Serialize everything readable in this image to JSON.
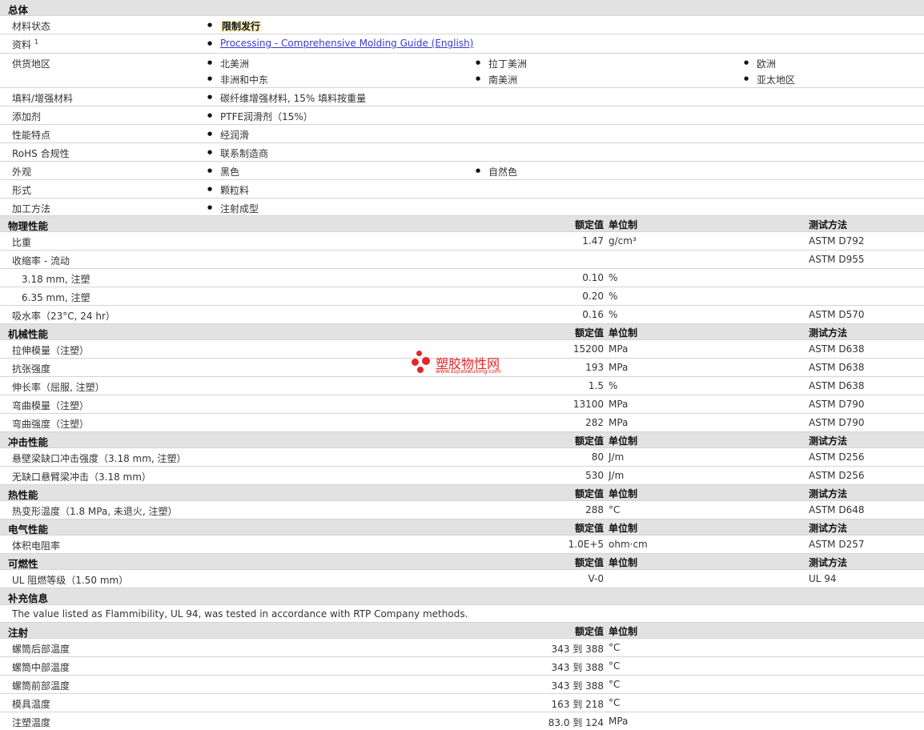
{
  "general": {
    "title": "总体",
    "material_status": {
      "label": "材料状态",
      "value": "限制发行"
    },
    "resources": {
      "label": "资料",
      "sup": "1",
      "link": "Processing - Comprehensive Molding Guide (English)"
    },
    "availability": {
      "label": "供货地区",
      "items": [
        "北美洲",
        "拉丁美洲",
        "欧洲",
        "非洲和中东",
        "南美洲",
        "亚太地区"
      ]
    },
    "filler": {
      "label": "填料/增强材料",
      "value": "碳纤维增强材料, 15% 填料按重量"
    },
    "additive": {
      "label": "添加剂",
      "value": "PTFE润滑剂（15%）"
    },
    "features": {
      "label": "性能特点",
      "value": "经润滑"
    },
    "rohs": {
      "label": "RoHS 合规性",
      "value": "联系制造商"
    },
    "appearance": {
      "label": "外观",
      "items": [
        "黑色",
        "自然色"
      ]
    },
    "form": {
      "label": "形式",
      "value": "颗粒料"
    },
    "processing": {
      "label": "加工方法",
      "value": "注射成型"
    }
  },
  "col_headers": {
    "nominal": "额定值",
    "unit": "单位制",
    "method": "测试方法"
  },
  "physical": {
    "title": "物理性能",
    "rows": [
      {
        "label": "比重",
        "value": "1.47",
        "unit": "g/cm³",
        "method": "ASTM D792"
      },
      {
        "label": "收缩率 - 流动",
        "value": "",
        "unit": "",
        "method": "ASTM D955"
      },
      {
        "label": "3.18 mm, 注塑",
        "value": "0.10",
        "unit": "%",
        "method": ""
      },
      {
        "label": "6.35 mm, 注塑",
        "value": "0.20",
        "unit": "%",
        "method": ""
      },
      {
        "label": "吸水率（23°C, 24 hr）",
        "value": "0.16",
        "unit": "%",
        "method": "ASTM D570"
      }
    ]
  },
  "mechanical": {
    "title": "机械性能",
    "rows": [
      {
        "label": "拉伸模量（注塑）",
        "value": "15200",
        "unit": "MPa",
        "method": "ASTM D638"
      },
      {
        "label": "抗张强度",
        "value": "193",
        "unit": "MPa",
        "method": "ASTM D638"
      },
      {
        "label": "伸长率（屈服, 注塑）",
        "value": "1.5",
        "unit": "%",
        "method": "ASTM D638"
      },
      {
        "label": "弯曲模量（注塑）",
        "value": "13100",
        "unit": "MPa",
        "method": "ASTM D790"
      },
      {
        "label": "弯曲强度（注塑）",
        "value": "282",
        "unit": "MPa",
        "method": "ASTM D790"
      }
    ]
  },
  "impact": {
    "title": "冲击性能",
    "rows": [
      {
        "label": "悬壁梁缺口冲击强度（3.18 mm, 注塑）",
        "value": "80",
        "unit": "J/m",
        "method": "ASTM D256"
      },
      {
        "label": "无缺口悬臂梁冲击（3.18 mm）",
        "value": "530",
        "unit": "J/m",
        "method": "ASTM D256"
      }
    ]
  },
  "thermal": {
    "title": "热性能",
    "rows": [
      {
        "label": "热变形温度（1.8 MPa, 未退火, 注塑）",
        "value": "288",
        "unit": "°C",
        "method": "ASTM D648"
      }
    ]
  },
  "electrical": {
    "title": "电气性能",
    "rows": [
      {
        "label": "体积电阻率",
        "value": "1.0E+5",
        "unit": "ohm·cm",
        "method": "ASTM D257"
      }
    ]
  },
  "flammability": {
    "title": "可燃性",
    "rows": [
      {
        "label": "UL 阻燃等级（1.50 mm）",
        "value": "V-0",
        "unit": "",
        "method": "UL 94"
      }
    ]
  },
  "supplemental": {
    "title": "补充信息",
    "note": "The value listed as Flammibility, UL 94, was tested in accordance with RTP Company methods."
  },
  "injection": {
    "title": "注射",
    "rows": [
      {
        "label": "螺筒后部温度",
        "value": "343 到 388",
        "unit": "°C"
      },
      {
        "label": "螺筒中部温度",
        "value": "343 到 388",
        "unit": "°C"
      },
      {
        "label": "螺筒前部温度",
        "value": "343 到 388",
        "unit": "°C"
      },
      {
        "label": "模具温度",
        "value": "163 到 218",
        "unit": "°C"
      },
      {
        "label": "注塑温度",
        "value": "83.0 到 124",
        "unit": "MPa"
      }
    ]
  },
  "watermark": {
    "text": "塑胶物性网",
    "url": "www.sujiaowuxing.com"
  }
}
